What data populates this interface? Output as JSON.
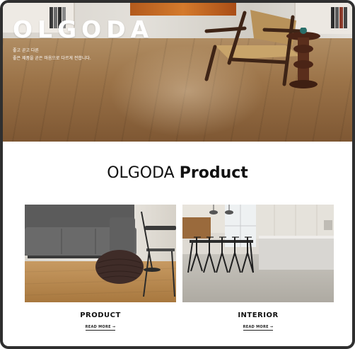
{
  "hero": {
    "logo": "OLGODA",
    "tagline_line1": "좋고 곧고 다른",
    "tagline_line2": "좋은 제품을 곧은 마음으로 다르게 전합니다."
  },
  "section": {
    "title_light": "OLGODA",
    "title_bold": "Product"
  },
  "cards": [
    {
      "title": "PRODUCT",
      "link_label": "READ MORE",
      "link_arrow": "→"
    },
    {
      "title": "INTERIOR",
      "link_label": "READ MORE",
      "link_arrow": "→"
    }
  ],
  "colors": {
    "frame": "#2f2f2f",
    "text": "#111111",
    "hero_text": "#ffffff"
  }
}
